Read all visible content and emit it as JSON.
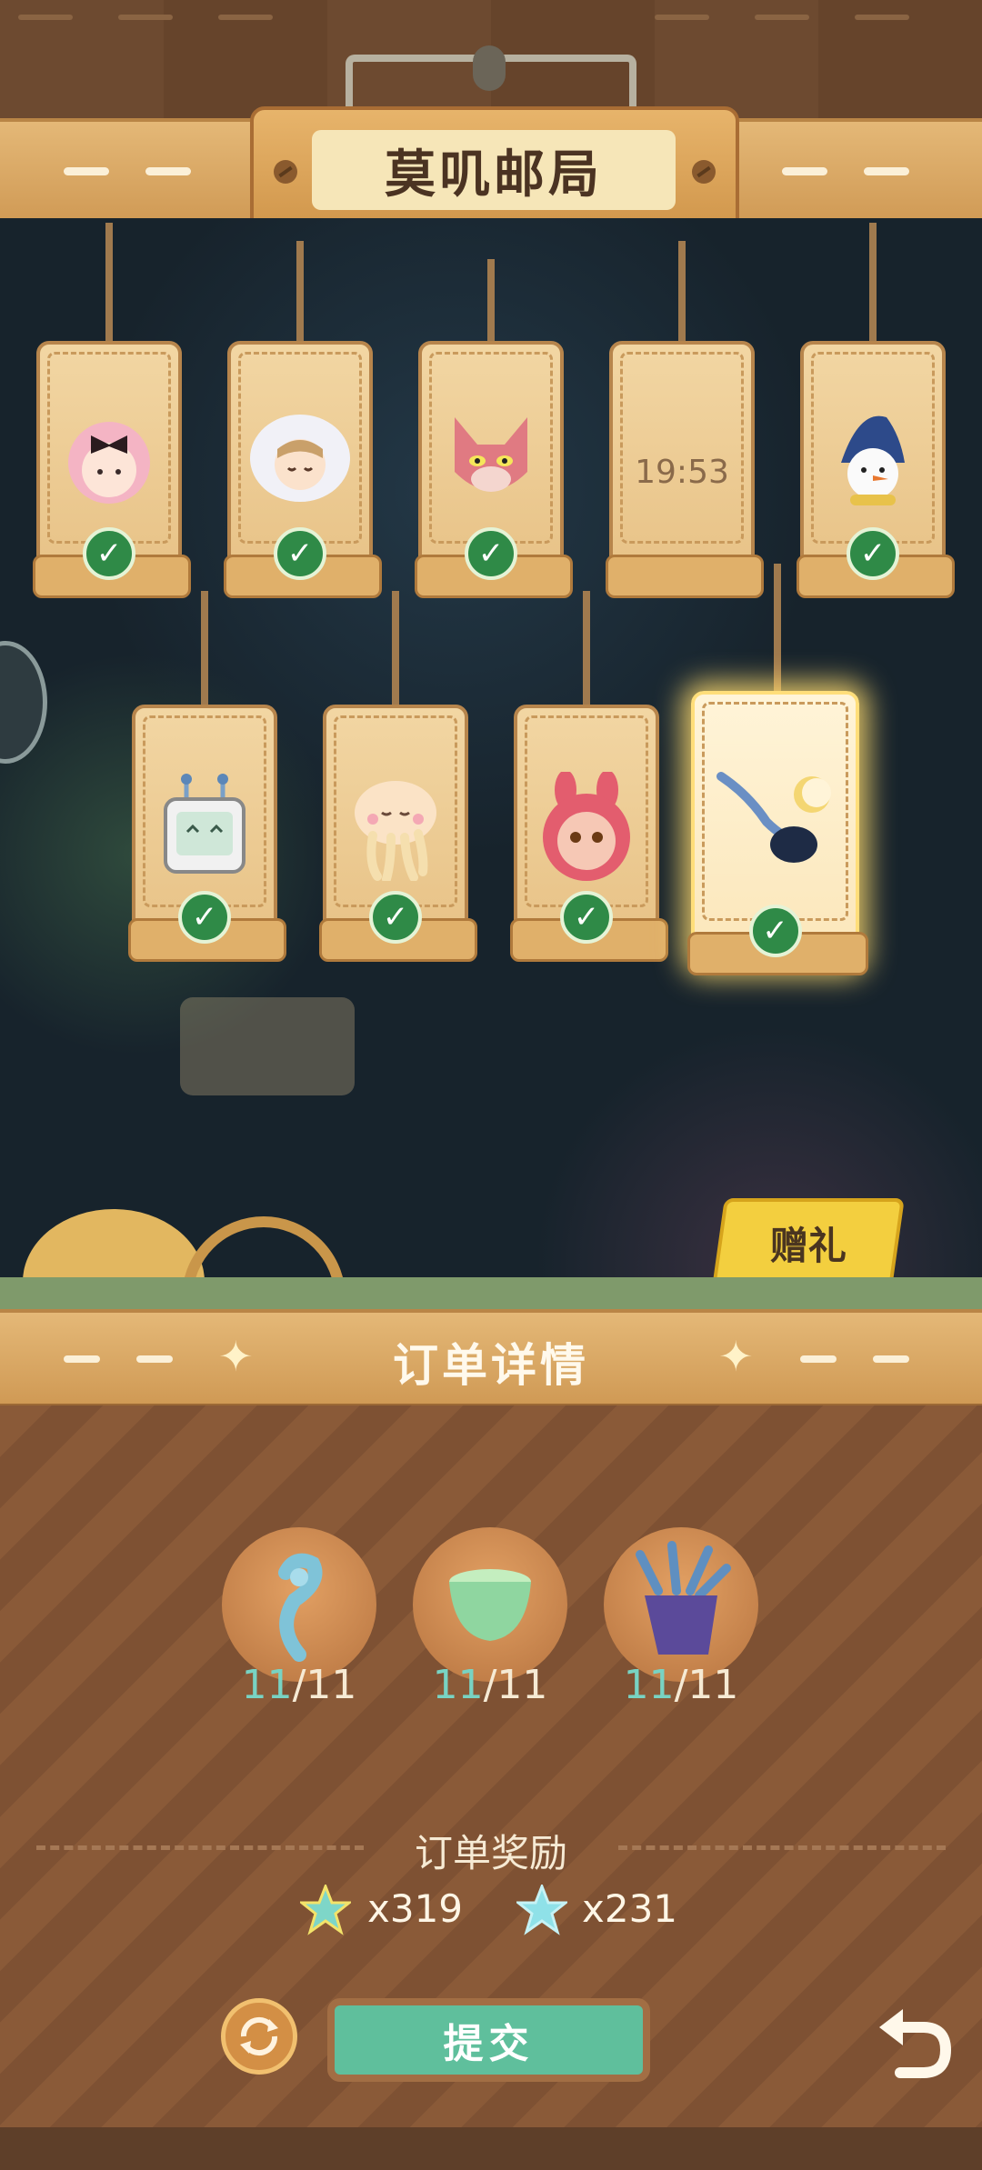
{
  "header": {
    "title": "莫叽邮局"
  },
  "tags_row1": [
    {
      "name": "pink-bow-girl",
      "status": "done"
    },
    {
      "name": "white-hood-child",
      "status": "done"
    },
    {
      "name": "pink-fox",
      "status": "done"
    },
    {
      "name": "timer",
      "status": "pending",
      "time": "19:53"
    },
    {
      "name": "snowman",
      "status": "done"
    }
  ],
  "tags_row2": [
    {
      "name": "robot",
      "status": "done"
    },
    {
      "name": "jellyfish",
      "status": "done"
    },
    {
      "name": "bunny-hood",
      "status": "done"
    },
    {
      "name": "moon-bird",
      "status": "done",
      "selected": true
    }
  ],
  "gift": {
    "label": "赠礼"
  },
  "order": {
    "title": "订单详情",
    "items": [
      {
        "icon": "blue-swirl-plant-icon",
        "have": "11",
        "need": "/11"
      },
      {
        "icon": "green-jelly-cup-icon",
        "have": "11",
        "need": "/11"
      },
      {
        "icon": "purple-plant-pot-icon",
        "have": "11",
        "need": "/11"
      }
    ],
    "reward_title": "订单奖励",
    "rewards": [
      {
        "icon": "rainbow-star-icon",
        "amount": "x319"
      },
      {
        "icon": "cyan-star-icon",
        "amount": "x231"
      }
    ],
    "submit_label": "提交"
  },
  "colors": {
    "check": "#2f8a47",
    "accent": "#5fbf9c",
    "have": "#78d3c3"
  }
}
